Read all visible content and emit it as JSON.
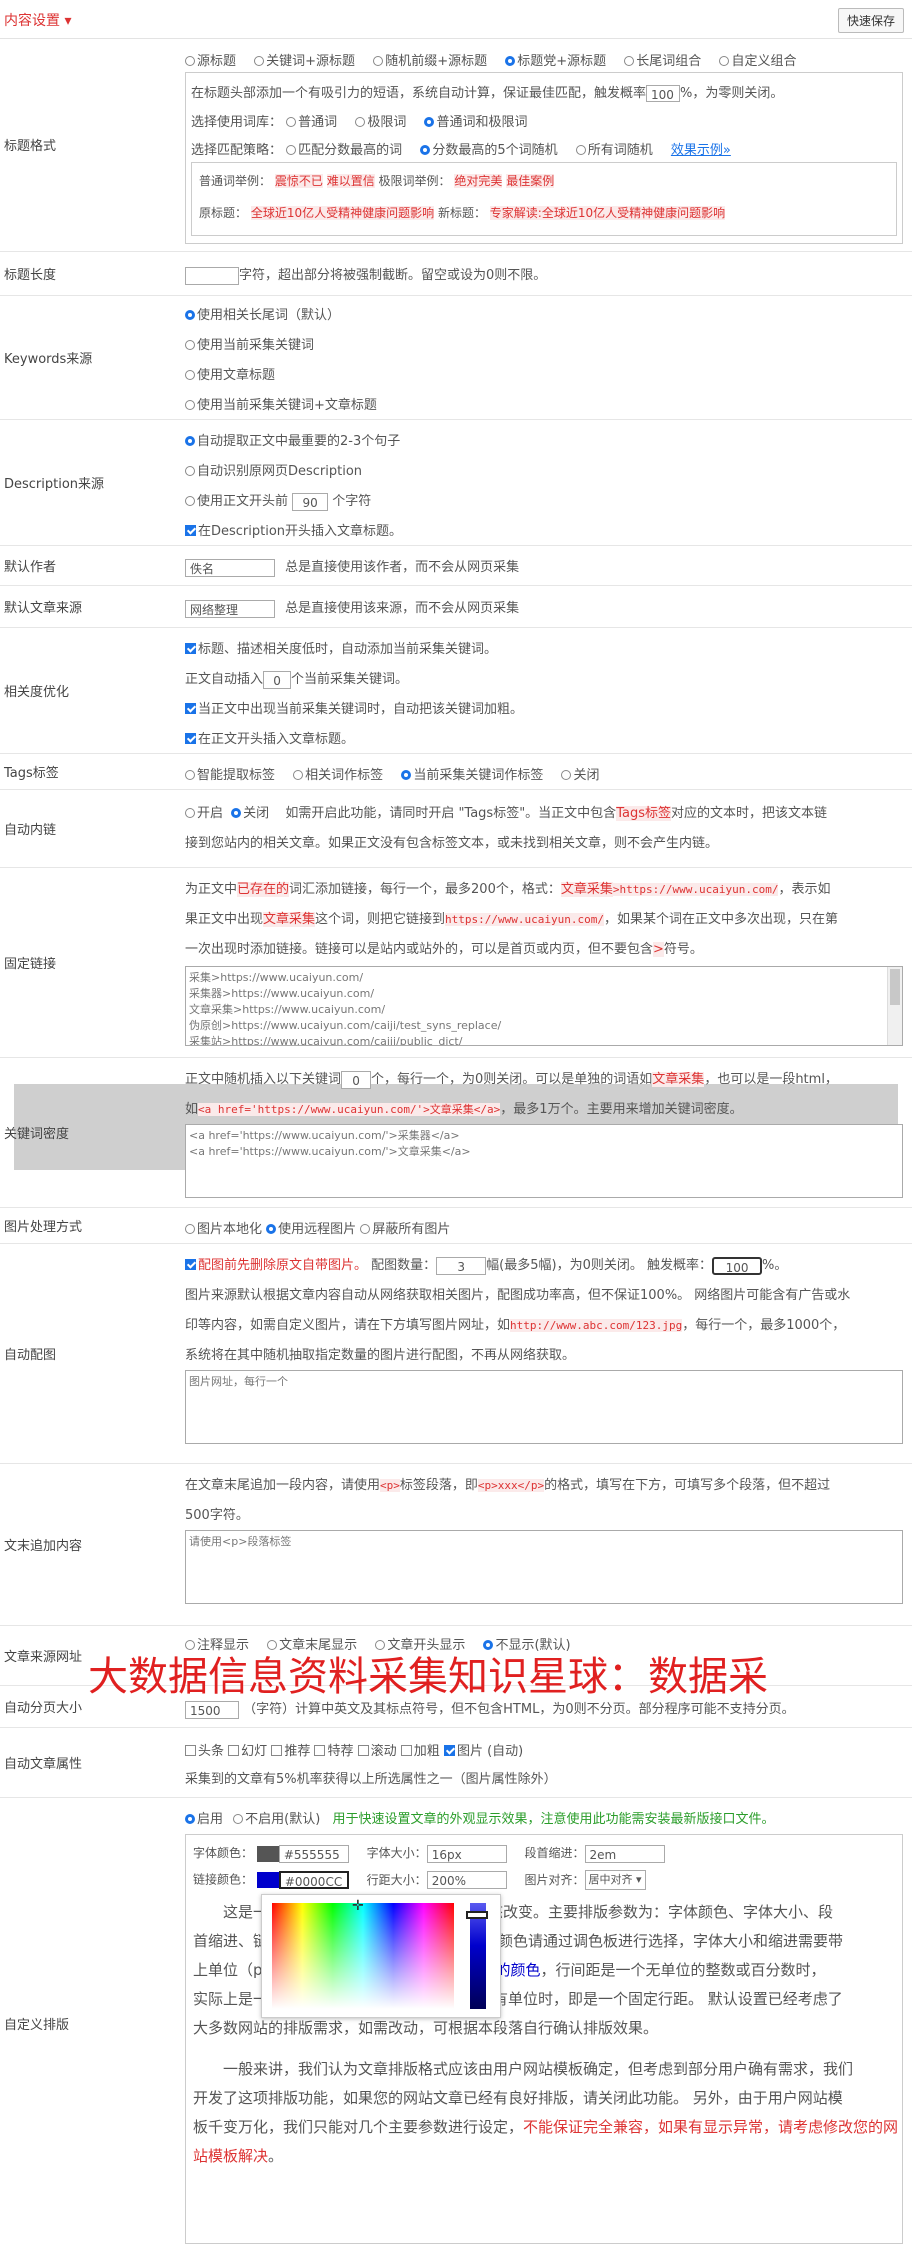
{
  "header": {
    "title": "内容设置 ▾",
    "save": "快速保存"
  },
  "title_format": {
    "label": "标题格式",
    "modes": [
      "源标题",
      "关键词+源标题",
      "随机前缀+源标题",
      "标题党+源标题",
      "长尾词组合",
      "自定义组合"
    ],
    "intro_a": "在标题头部添加一个有吸引力的短语，系统自动计算，保证最佳匹配，触发概率",
    "prob": "100",
    "intro_b": "%，为零则关闭。",
    "lexicon_label": "选择使用词库：",
    "lexicons": [
      "普通词",
      "极限词",
      "普通词和极限词"
    ],
    "strategy_label": "选择匹配策略：",
    "strategies": [
      "匹配分数最高的词",
      "分数最高的5个词随机",
      "所有词随机"
    ],
    "effect_link": "效果示例»",
    "ex1_label": "普通词举例：",
    "ex1_vals": [
      "震惊不已",
      "难以置信"
    ],
    "ex2_label": "极限词举例：",
    "ex2_vals": [
      "绝对完美",
      "最佳案例"
    ],
    "ex3_label": "原标题：",
    "ex3_val": "全球近10亿人受精神健康问题影响",
    "ex4_label": "新标题：",
    "ex4_val": "专家解读:全球近10亿人受精神健康问题影响"
  },
  "title_len": {
    "label": "标题长度",
    "value": "",
    "desc": "字符，超出部分将被强制截断。留空或设为0则不限。"
  },
  "keywords": {
    "label": "Keywords来源",
    "options": [
      "使用相关长尾词（默认）",
      "使用当前采集关键词",
      "使用文章标题",
      "使用当前采集关键词+文章标题"
    ]
  },
  "description": {
    "label": "Description来源",
    "options": [
      "自动提取正文中最重要的2-3个句子",
      "自动识别原网页Description"
    ],
    "opt3a": "使用正文开头前",
    "opt3_val": "90",
    "opt3b": "个字符",
    "opt4": "在Description开头插入文章标题。"
  },
  "author": {
    "label": "默认作者",
    "value": "佚名",
    "desc": "总是直接使用该作者，而不会从网页采集"
  },
  "source": {
    "label": "默认文章来源",
    "value": "网络整理",
    "desc": "总是直接使用该来源，而不会从网页采集"
  },
  "relevance": {
    "label": "相关度优化",
    "opt1": "标题、描述相关度低时，自动添加当前采集关键词。",
    "opt2a": "正文自动插入",
    "opt2_val": "0",
    "opt2b": "个当前采集关键词。",
    "opt3": "当正文中出现当前采集关键词时，自动把该关键词加粗。",
    "opt4": "在正文开头插入文章标题。"
  },
  "tags": {
    "label": "Tags标签",
    "options": [
      "智能提取标签",
      "相关词作标签",
      "当前采集关键词作标签",
      "关闭"
    ]
  },
  "autolink": {
    "label": "自动内链",
    "options": [
      "开启",
      "关闭"
    ],
    "desc1a": "如需开启此功能，请同时开启 \"Tags标签\"。当正文中包含",
    "desc1_tag": "Tags标签",
    "desc1b": "对应的文本时，把该文本链",
    "desc2": "接到您站内的相关文章。如果正文没有包含标签文本，或未找到相关文章，则不会产生内链。"
  },
  "fixed_link": {
    "label": "固定链接",
    "l1a": "为正文中",
    "l1b": "已存在的",
    "l1c": "词汇添加链接，每行一个，最多200个，格式：",
    "l1d": "文章采集",
    "l1e": ">https://www.ucaiyun.com/",
    "l1f": "，表示如",
    "l2a": "果正文中出现",
    "l2b": "文章采集",
    "l2c": "这个词，则把它链接到",
    "l2d": "https://www.ucaiyun.com/",
    "l2e": "，如果某个词在正文中多次出现，只在第",
    "l3a": "一次出现时添加链接。链接可以是站内或站外的，可以是首页或内页，但不要包含",
    "l3b": ">",
    "l3c": "符号。",
    "textarea": "采集>https://www.ucaiyun.com/\n采集器>https://www.ucaiyun.com/\n文章采集>https://www.ucaiyun.com/\n伪原创>https://www.ucaiyun.com/caiji/test_syns_replace/\n采集站>https://www.ucaiyun.com/caiji/public_dict/"
  },
  "kw_density": {
    "label": "关键词密度",
    "l1a": "正文中随机插入以下关键词",
    "l1_val": "0",
    "l1b": "个，每行一个，为0则关闭。可以是单独的词语如",
    "l1c": "文章采集",
    "l1d": "，也可以是一段html，",
    "l2a": "如",
    "l2b": "<a href='https://www.ucaiyun.com/'>文章采集</a>",
    "l2c": "，最多1万个。主要用来增加关键词密度。",
    "textarea": "<a href='https://www.ucaiyun.com/'>采集器</a>\n<a href='https://www.ucaiyun.com/'>文章采集</a>"
  },
  "image_mode": {
    "label": "图片处理方式",
    "options": [
      "图片本地化",
      "使用远程图片",
      "屏蔽所有图片"
    ]
  },
  "auto_image": {
    "label": "自动配图",
    "l1a": "配图前先删除原文自带图片。",
    "l1b": "配图数量：",
    "l1_val": "3",
    "l1c": "幅(最多5幅)，为0则关闭。",
    "l1d": "触发概率：",
    "l1_prob": "100",
    "l1e": "%。",
    "l2": "图片来源默认根据文章内容自动从网络获取相关图片，配图成功率高，但不保证100%。 网络图片可能含有广告或水",
    "l3a": "印等内容，如需自定义图片，请在下方填写图片网址，如",
    "l3b": "http://www.abc.com/123.jpg",
    "l3c": "，每行一个，最多1000个，",
    "l4": "系统将在其中随机抽取指定数量的图片进行配图，不再从网络获取。",
    "placeholder": "图片网址，每行一个"
  },
  "append": {
    "label": "文末追加内容",
    "l1a": "在文章末尾追加一段内容，请使用",
    "l1b": "<p>",
    "l1c": "标签段落，即",
    "l1d": "<p>xxx</p>",
    "l1e": "的格式，填写在下方，可填写多个段落，但不超过",
    "l2": "500字符。",
    "placeholder": "请使用<p>段落标签"
  },
  "src_url": {
    "label": "文章来源网址",
    "options": [
      "注释显示",
      "文章末尾显示",
      "文章开头显示",
      "不显示(默认)"
    ]
  },
  "watermark": "大数据信息资料采集知识星球：数据采",
  "paging": {
    "label": "自动分页大小",
    "value": "1500",
    "desc": "（字符）计算中英文及其标点符号，但不包含HTML，为0则不分页。部分程序可能不支持分页。"
  },
  "attrs": {
    "label": "自动文章属性",
    "options": [
      "头条",
      "幻灯",
      "推荐",
      "特荐",
      "滚动",
      "加粗",
      "图片 (自动)"
    ],
    "note": "采集到的文章有5%机率获得以上所选属性之一（图片属性除外）"
  },
  "typeset": {
    "label": "自定义排版",
    "options": [
      "启用",
      "不启用(默认)"
    ],
    "note": "用于快速设置文章的外观显示效果，注意使用此功能需安装最新版接口文件。",
    "font_color_label": "字体颜色：",
    "font_color": "#555555",
    "font_size_label": "字体大小：",
    "font_size": "16px",
    "indent_label": "段首缩进：",
    "indent": "2em",
    "link_color_label": "链接颜色：",
    "link_color": "#0000CC",
    "line_height_label": "行距大小：",
    "line_height": "200%",
    "img_align_label": "图片对齐：",
    "img_align": "居中对齐",
    "p1_l1a": "这是一",
    "p1_l1b": "置动态改变。主要排版参数为：字体颜色、字体大小、段",
    "p1_l2a": "首缩进、链",
    "p1_l2b": "颜色请通过调色板进行选择，字体大小和缩进需要带",
    "p1_l3a": "上单位（p",
    "p1_l3b": "注意它的颜色",
    "p1_l3c": "，行间距是一个无单位的整数或百分数时，",
    "p1_l4": "实际上是一个以字体大小为基数的行距倍数；有单位时，即是一个固定行距。 默认设置已经考虑了",
    "p1_l5": "大多数网站的排版需求，如需改动，可根据本段落自行确认排版效果。",
    "p2_l1": "一般来讲，我们认为文章排版格式应该由用户网站模板确定，但考虑到部分用户确有需求，我们",
    "p2_l2": "开发了这项排版功能，如果您的网站文章已经有良好排版，请关闭此功能。 另外，由于用户网站模",
    "p2_l3a": "板千变万化，我们只能对几个主要参数进行设定，",
    "p2_l3b": "不能保证完全兼容，如果有显示异常，请考虑修改您的网",
    "p2_l4a": "站模板解决",
    "p2_l4b": "。"
  }
}
